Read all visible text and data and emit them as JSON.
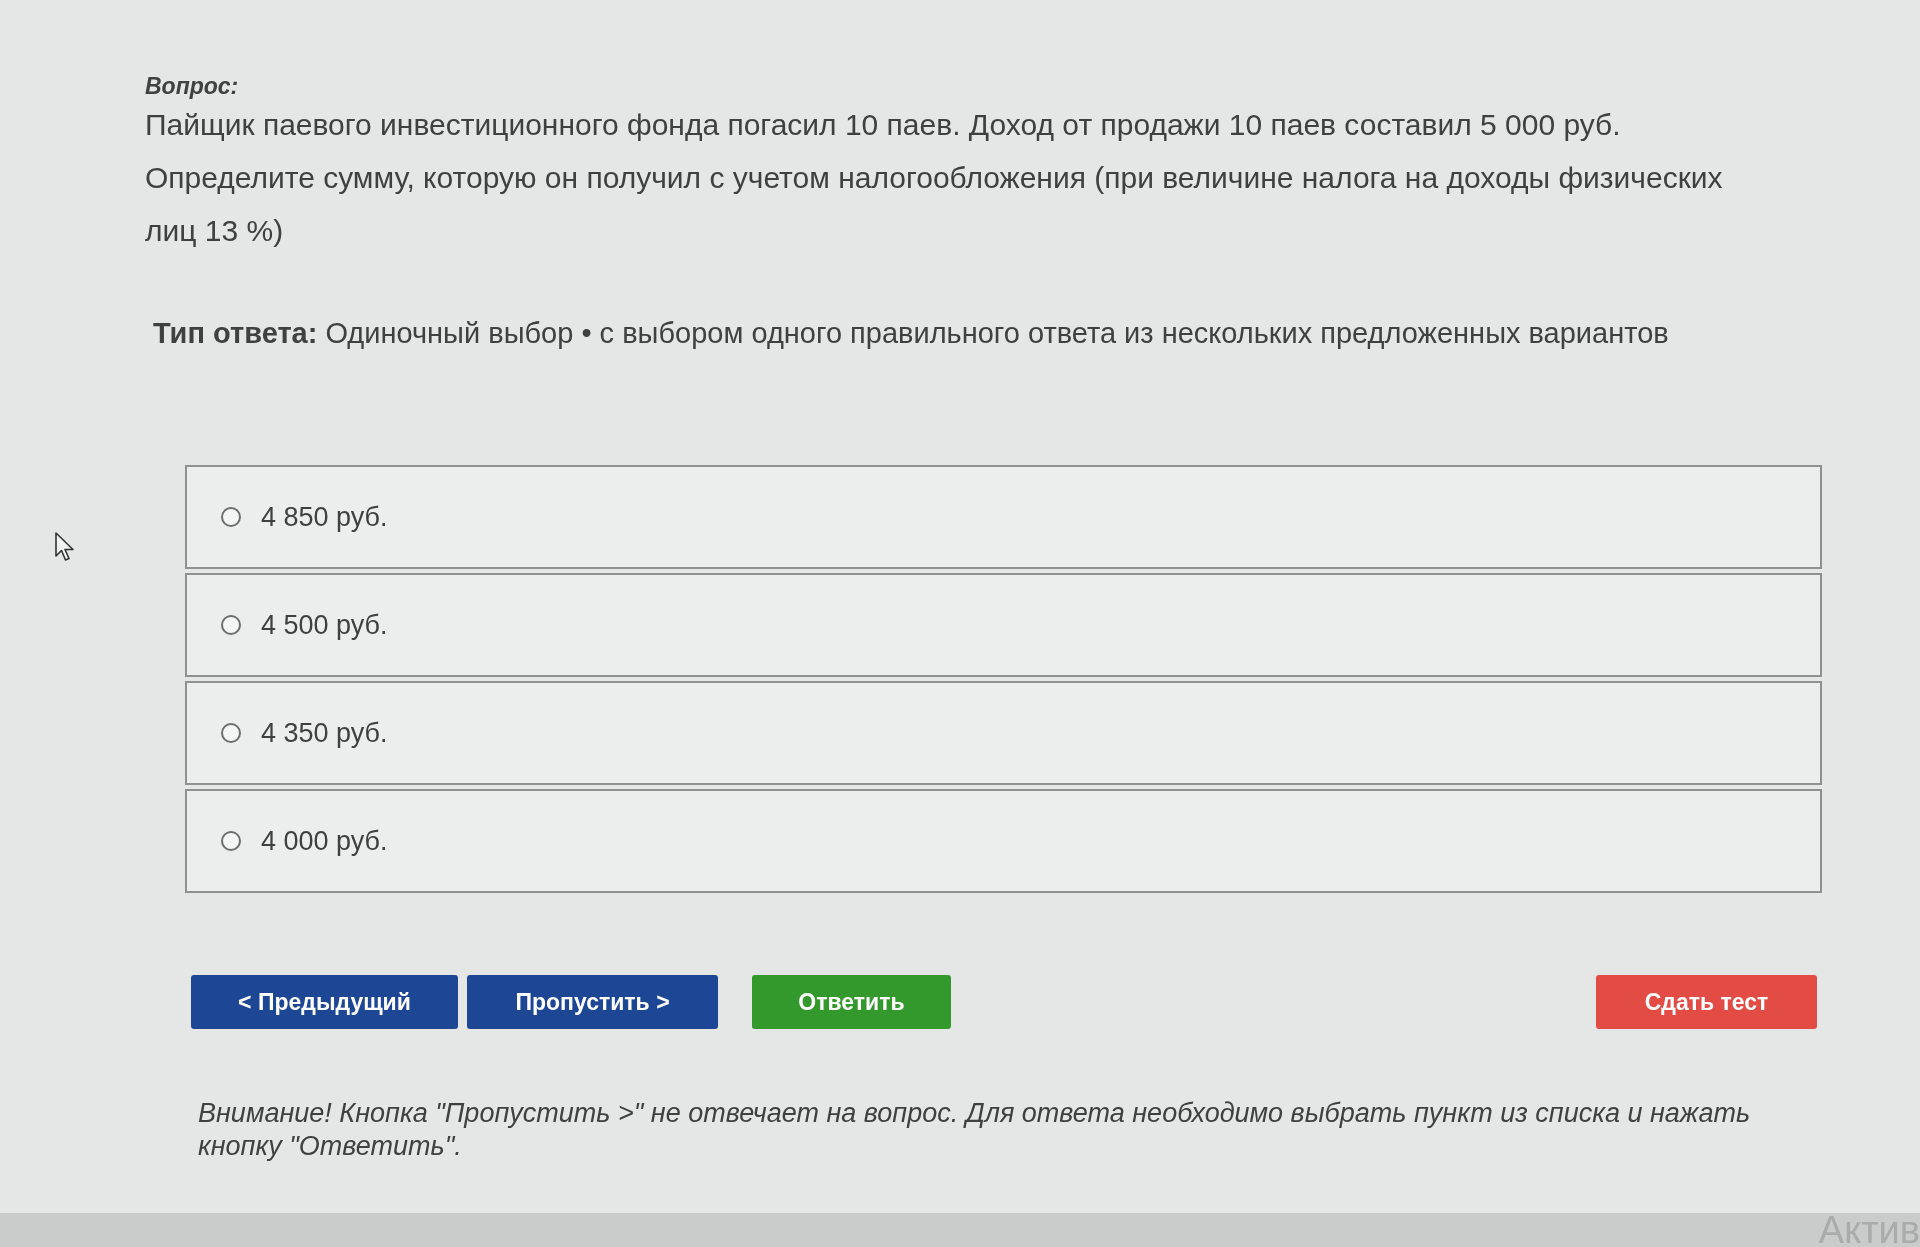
{
  "question": {
    "label": "Вопрос:",
    "paragraphs": [
      "Пайщик паевого инвестиционного фонда погасил 10 паев. Доход от продажи 10 паев составил 5 000 руб.",
      "Определите сумму, которую он получил с учетом налогообложения (при величине налога на доходы физических лиц 13 %)"
    ]
  },
  "answer_type": "**Тип ответа:** Одиночный выбор • с выбором одного правильного ответа из нескольких предложенных вариантов",
  "options": [
    {
      "label": "4 850 руб.",
      "selected": false
    },
    {
      "label": "4 500 руб.",
      "selected": false
    },
    {
      "label": "4 350 руб.",
      "selected": false
    },
    {
      "label": "4 000 руб.",
      "selected": false
    }
  ],
  "buttons": [
    {
      "label": "< Предыдущий",
      "kind": "nav"
    },
    {
      "label": "Пропустить >",
      "kind": "nav"
    },
    {
      "label": "Ответить",
      "kind": "answer"
    },
    {
      "label": "Сдать тест",
      "kind": "finish"
    }
  ],
  "notice": "Внимание! Кнопка \"Пропустить >\" не отвечает на вопрос. Для ответа необходимо выбрать пункт из списка и нажать кнопку \"Ответить\".",
  "status_strip": {
    "text": "Актив"
  }
}
